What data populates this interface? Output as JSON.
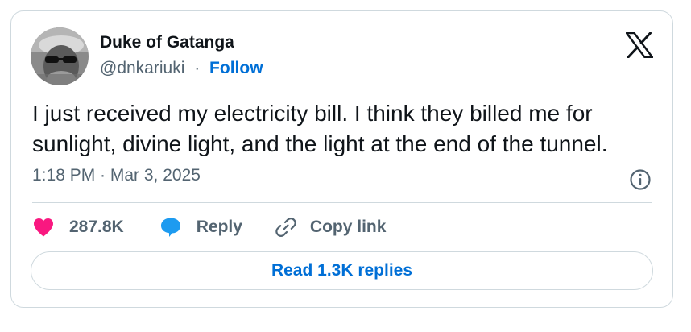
{
  "author": {
    "name": "Duke of Gatanga",
    "handle": "@dnkariuki",
    "separator": "·",
    "follow_label": "Follow"
  },
  "tweet": {
    "text": "I just received my electricity bill. I think they billed me for sunlight, divine light, and the light at the end of the tunnel.",
    "timestamp": "1:18 PM · Mar 3, 2025"
  },
  "actions": {
    "like_count": "287.8K",
    "reply_label": "Reply",
    "copy_link_label": "Copy link"
  },
  "read_replies_label": "Read 1.3K replies",
  "icons": {
    "logo": "x-logo-icon",
    "info": "info-icon",
    "like": "heart-icon",
    "reply": "speech-bubble-icon",
    "copy": "link-icon"
  },
  "colors": {
    "like": "#f91880",
    "reply": "#1d9bf0",
    "link": "#006fd6",
    "secondary_text": "#536471",
    "primary_text": "#0f1419",
    "border": "#cfd9de"
  }
}
